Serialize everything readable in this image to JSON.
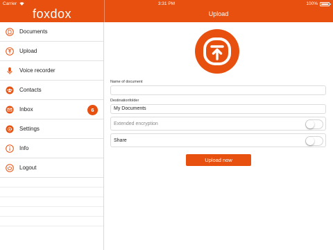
{
  "status_bar": {
    "carrier": "Carrier",
    "time": "3:31 PM",
    "battery": "100%"
  },
  "header": {
    "logo": "foxdox",
    "title": "Upload"
  },
  "colors": {
    "accent": "#e8500f"
  },
  "sidebar": {
    "items": [
      {
        "label": "Documents",
        "icon": "document-icon"
      },
      {
        "label": "Upload",
        "icon": "upload-icon"
      },
      {
        "label": "Voice recorder",
        "icon": "microphone-icon"
      },
      {
        "label": "Contacts",
        "icon": "contacts-icon"
      },
      {
        "label": "Inbox",
        "icon": "inbox-icon",
        "badge": "6"
      },
      {
        "label": "Settings",
        "icon": "gear-icon"
      },
      {
        "label": "Info",
        "icon": "info-icon"
      },
      {
        "label": "Logout",
        "icon": "power-icon"
      }
    ]
  },
  "form": {
    "name_label": "Name of document",
    "name_value": "",
    "folder_label": "Destinationfolder",
    "folder_value": "My Documents",
    "encryption_label": "Extended encryption",
    "encryption_on": false,
    "share_label": "Share",
    "share_on": false,
    "upload_button": "Upload now"
  }
}
